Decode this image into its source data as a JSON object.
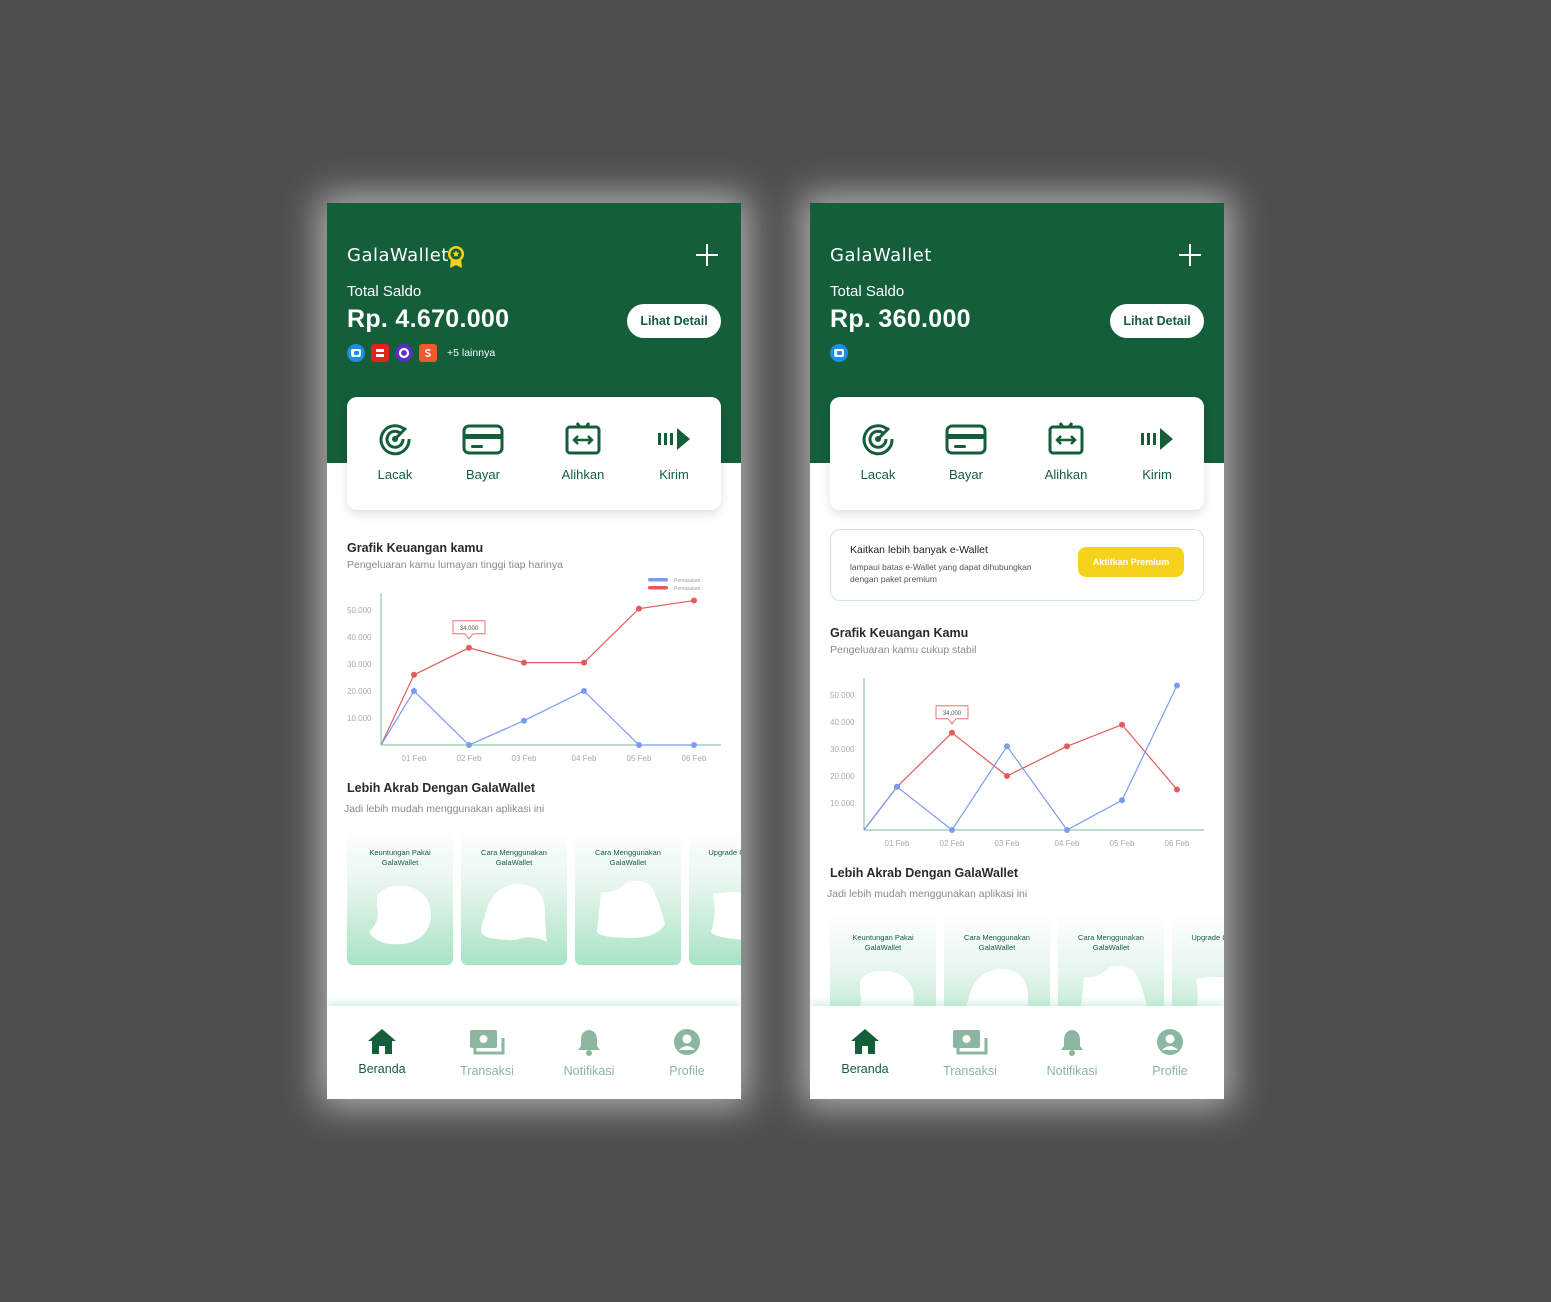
{
  "colors": {
    "brand": "#145e3a",
    "accent": "#f7d21b",
    "red_series": "#e45b5b",
    "blue_series": "#7a9cf2"
  },
  "screens": [
    {
      "brand": "GalaWallet",
      "saldo_label": "Total Saldo",
      "saldo_amount": "Rp. 4.670.000",
      "detail_button": "Lihat Detail",
      "wallets_more": "+5 lainnya",
      "actions": [
        "Lacak",
        "Bayar",
        "Alihkan",
        "Kirim"
      ],
      "chart_title": "Grafik Keuangan kamu",
      "chart_sub": "Pengeluaran kamu lumayan tinggi tiap harinya",
      "section_title": "Lebih Akrab Dengan GalaWallet",
      "section_sub": "Jadi lebih mudah menggunakan aplikasi ini",
      "cards": [
        "Keuntungan Pakai GalaWallet",
        "Cara Menggunakan GalaWallet",
        "Cara Menggunakan GalaWallet",
        "Upgrade GalaWallet"
      ],
      "nav": [
        "Beranda",
        "Transaksi",
        "Notifikasi",
        "Profile"
      ]
    },
    {
      "brand": "GalaWallet",
      "saldo_label": "Total Saldo",
      "saldo_amount": "Rp. 360.000",
      "detail_button": "Lihat Detail",
      "actions": [
        "Lacak",
        "Bayar",
        "Alihkan",
        "Kirim"
      ],
      "premium_title": "Kaitkan lebih banyak e-Wallet",
      "premium_desc": "lampaui batas e-Wallet yang dapat dihubungkan dengan paket premium",
      "premium_button": "Aktifkan Premium",
      "chart_title": "Grafik Keuangan Kamu",
      "chart_sub": "Pengeluaran kamu cukup stabil",
      "section_title": "Lebih Akrab Dengan GalaWallet",
      "section_sub": "Jadi lebih mudah menggunakan aplikasi ini",
      "cards": [
        "Keuntungan Pakai GalaWallet",
        "Cara Menggunakan GalaWallet",
        "Cara Menggunakan GalaWallet",
        "Upgrade GalaWallet"
      ],
      "nav": [
        "Beranda",
        "Transaksi",
        "Notifikasi",
        "Profile"
      ]
    }
  ],
  "chart_data": [
    {
      "type": "line",
      "title": "Grafik Keuangan kamu",
      "subtitle": "Pengeluaran kamu lumayan tinggi tiap harinya",
      "x": [
        "01 Feb",
        "02 Feb",
        "03 Feb",
        "04 Feb",
        "05 Feb",
        "06 Feb"
      ],
      "yticks": [
        "10.000",
        "20.000",
        "30.000",
        "40.000",
        "50.000"
      ],
      "ylim": [
        0,
        55000
      ],
      "legend": [
        "Pemasukan",
        "Pemasukan"
      ],
      "legend_position": "top-right",
      "annotation": {
        "x": "02 Feb",
        "label": "34.000"
      },
      "series": [
        {
          "name": "Pemasukan",
          "color": "#e45b5b",
          "values": [
            26000,
            36000,
            30500,
            30500,
            50500,
            53500
          ]
        },
        {
          "name": "Pemasukan",
          "color": "#7a9cf2",
          "values": [
            20000,
            0,
            9000,
            20000,
            0,
            0
          ]
        }
      ]
    },
    {
      "type": "line",
      "title": "Grafik Keuangan Kamu",
      "subtitle": "Pengeluaran kamu cukup stabil",
      "x": [
        "01 Feb",
        "02 Feb",
        "03 Feb",
        "04 Feb",
        "05 Feb",
        "06 Feb"
      ],
      "yticks": [
        "10.000",
        "20.000",
        "30.000",
        "40.000",
        "50.000"
      ],
      "ylim": [
        0,
        55000
      ],
      "annotation": {
        "x": "02 Feb",
        "label": "34.000"
      },
      "series": [
        {
          "color": "#e45b5b",
          "values": [
            16000,
            36000,
            20000,
            31000,
            39000,
            15000
          ]
        },
        {
          "color": "#7a9cf2",
          "values": [
            16000,
            0,
            31000,
            0,
            11000,
            53500
          ]
        }
      ]
    }
  ]
}
